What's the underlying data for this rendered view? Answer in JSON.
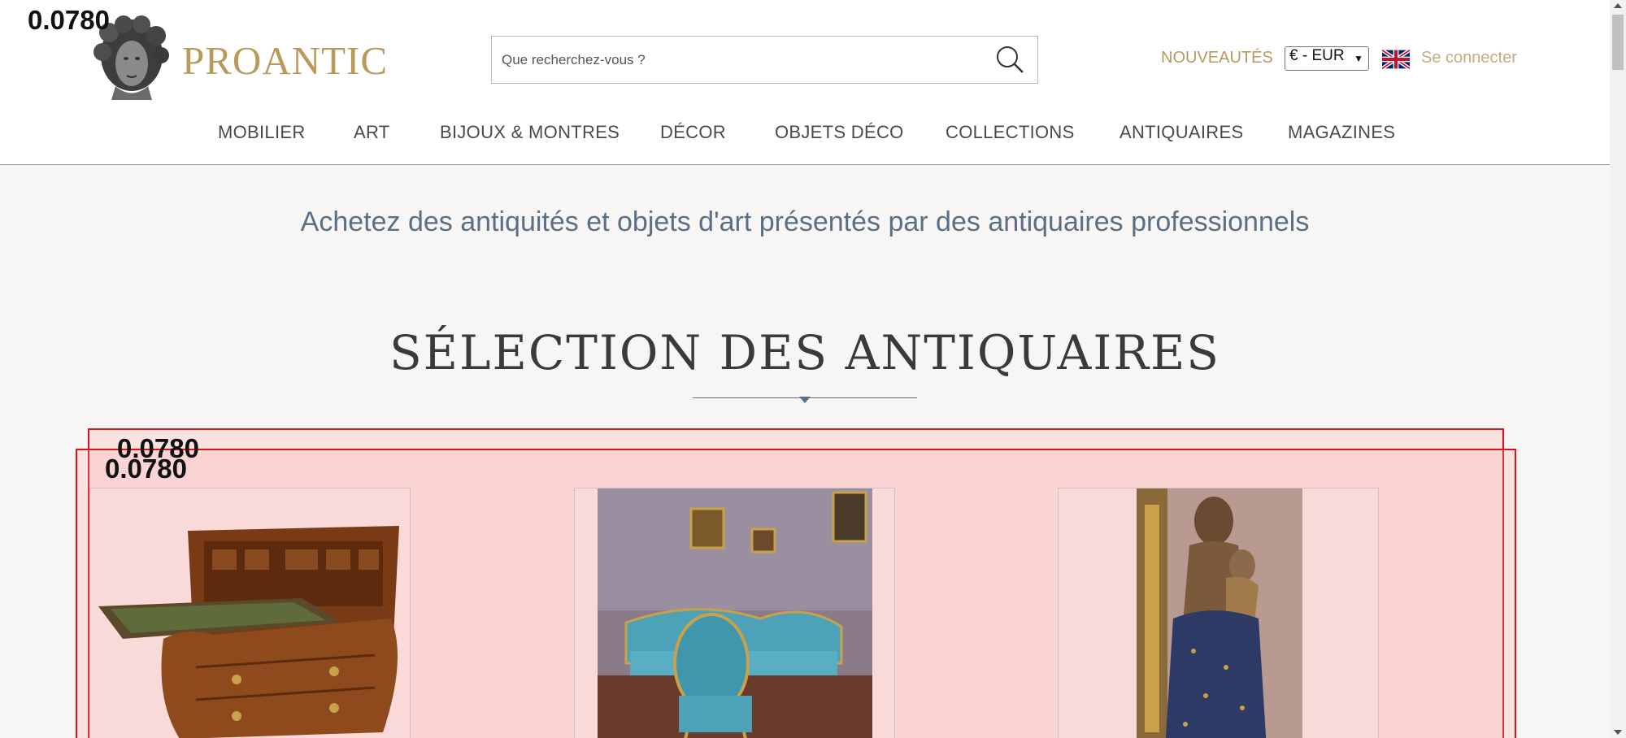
{
  "overlay": {
    "score_label": "0.0780"
  },
  "header": {
    "logo_text": "PROANTIC",
    "search": {
      "placeholder": "Que recherchez-vous ?"
    },
    "nouveautes": "NOUVEAUTÉS",
    "currency": "€ - EUR",
    "login": "Se connecter"
  },
  "nav": {
    "items": [
      {
        "label": "MOBILIER"
      },
      {
        "label": "ART"
      },
      {
        "label": "BIJOUX & MONTRES"
      },
      {
        "label": "DÉCOR"
      },
      {
        "label": "OBJETS DÉCO"
      },
      {
        "label": "COLLECTIONS"
      },
      {
        "label": "ANTIQUAIRES"
      },
      {
        "label": "MAGAZINES"
      }
    ]
  },
  "main": {
    "tagline": "Achetez des antiquités et objets d'art présentés par des antiquaires professionnels",
    "section_title": "SÉLECTION DES ANTIQUAIRES"
  },
  "colors": {
    "brand_gold": "#b99a5b",
    "nav_text": "#4a4a4a",
    "tagline_blue": "#5a6f86",
    "overlay_red": "#e3101c"
  }
}
